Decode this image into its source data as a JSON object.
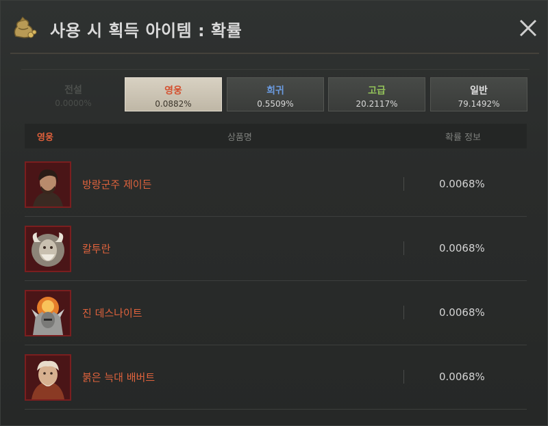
{
  "window": {
    "title": "사용 시 획득 아이템 : 확률",
    "title_icon": "gold-bag-icon",
    "close_icon": "close-icon"
  },
  "colors": {
    "hero": "#e0603b",
    "rare": "#6b9be0",
    "advanced": "#93c25a",
    "normal": "#d9d9d9",
    "legendary_dim": "#4d504d"
  },
  "tabs": [
    {
      "label": "전설",
      "prob": "0.0000%",
      "state": "disabled"
    },
    {
      "label": "영웅",
      "prob": "0.0882%",
      "state": "active"
    },
    {
      "label": "희귀",
      "prob": "0.5509%",
      "state": "normal"
    },
    {
      "label": "고급",
      "prob": "20.2117%",
      "state": "normal"
    },
    {
      "label": "일반",
      "prob": "79.1492%",
      "state": "normal"
    }
  ],
  "table": {
    "grade_label": "영웅",
    "name_header": "상품명",
    "prob_header": "확률 정보"
  },
  "items": [
    {
      "name": "방랑군주 제이든",
      "prob": "0.0068%",
      "icon": "jayden-portrait-icon"
    },
    {
      "name": "칼투란",
      "prob": "0.0068%",
      "icon": "kaltuan-portrait-icon"
    },
    {
      "name": "진 데스나이트",
      "prob": "0.0068%",
      "icon": "death-knight-portrait-icon"
    },
    {
      "name": "붉은 늑대 배버트",
      "prob": "0.0068%",
      "icon": "red-wolf-portrait-icon"
    }
  ]
}
